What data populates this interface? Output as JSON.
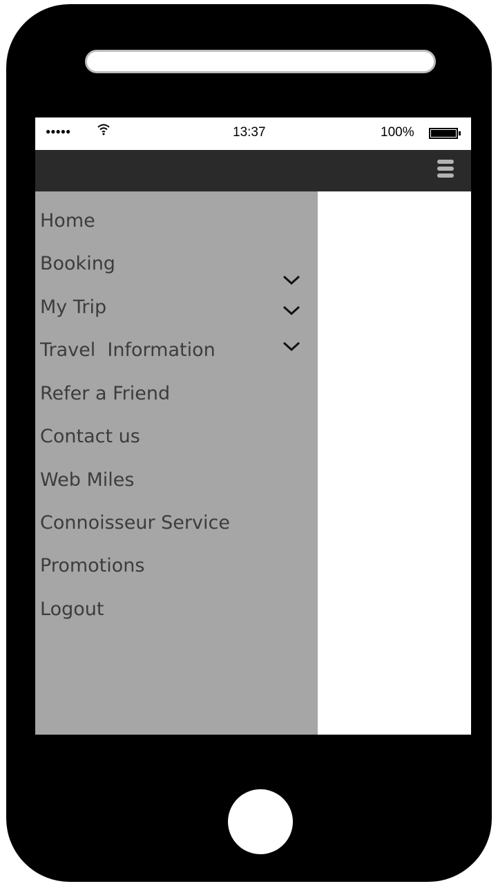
{
  "status_bar": {
    "signal": "●●●●●",
    "wifi_icon": "wifi-icon",
    "time": "13:37",
    "battery_percent": "100%"
  },
  "header": {
    "menu_icon": "hamburger-icon"
  },
  "menu": {
    "items": [
      {
        "label": "Home"
      },
      {
        "label": "Booking",
        "expandable": true
      },
      {
        "label": "My Trip",
        "expandable": true
      },
      {
        "label": "Travel  Information",
        "expandable": true
      },
      {
        "label": "Refer a Friend"
      },
      {
        "label": "Contact us"
      },
      {
        "label": "Web Miles"
      },
      {
        "label": "Connoisseur Service"
      },
      {
        "label": "Promotions"
      },
      {
        "label": "Logout"
      }
    ]
  },
  "colors": {
    "phone_body": "#000000",
    "header_bg": "#2a2a2a",
    "drawer_bg": "#a6a6a6",
    "menu_text": "#3c3c3c"
  }
}
